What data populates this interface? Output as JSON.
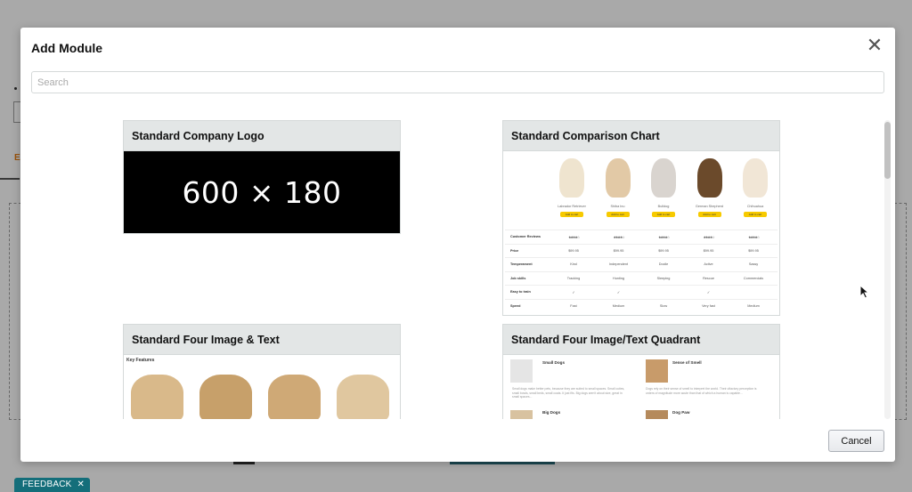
{
  "modal": {
    "title": "Add Module",
    "close_symbol": "✕",
    "search_placeholder": "Search",
    "cancel_label": "Cancel"
  },
  "background": {
    "orange_text": "E",
    "feedback_label": "FEEDBACK",
    "feedback_close": "✕"
  },
  "modules": {
    "company_logo": {
      "title": "Standard Company Logo",
      "preview_text": "600 × 180"
    },
    "comparison_chart": {
      "title": "Standard Comparison Chart",
      "dogs": [
        {
          "name": "Labrador Retriever",
          "button": "Add to cart",
          "color": "#efe4cf"
        },
        {
          "name": "Shiba Inu",
          "button": "Add to cart",
          "color": "#e2c9a6"
        },
        {
          "name": "Bulldog",
          "button": "Add to cart",
          "color": "#d9d4cf"
        },
        {
          "name": "German Shepherd",
          "button": "Add to cart",
          "color": "#6b4a2b"
        },
        {
          "name": "Chihuahua",
          "button": "Add to cart",
          "color": "#f1e6d6"
        }
      ],
      "rows": [
        {
          "label": "Customer Reviews",
          "cells": [
            "★★★★☆",
            "★★★★☆",
            "★★★★☆",
            "★★★★☆",
            "★★★★☆"
          ]
        },
        {
          "label": "Price",
          "cells": [
            "$99.95",
            "$99.95",
            "$99.95",
            "$99.95",
            "$99.95"
          ]
        },
        {
          "label": "Temperament",
          "cells": [
            "Kind",
            "Independent",
            "Docile",
            "Active",
            "Sassy"
          ]
        },
        {
          "label": "Job skills",
          "cells": [
            "Tracking",
            "Hunting",
            "Sleeping",
            "Rescue",
            "Commercials"
          ]
        },
        {
          "label": "Easy to train",
          "cells": [
            "✓",
            "✓",
            "",
            "✓",
            ""
          ]
        },
        {
          "label": "Speed",
          "cells": [
            "Fast",
            "Medium",
            "Slow",
            "Very fast",
            "Medium"
          ]
        }
      ]
    },
    "four_image_text": {
      "title": "Standard Four Image & Text",
      "section_label": "Key Features",
      "images": [
        "#d9b98a",
        "#c7a06a",
        "#cfa976",
        "#e0c79f"
      ]
    },
    "four_image_quadrant": {
      "title": "Standard Four Image/Text Quadrant",
      "items": [
        {
          "title": "Small Dogs",
          "text": "Small dogs make better pets, because they are suited to small spaces. Small cuties, small bowls, small beds, small coats. It just fits. Big dogs aren't about size, great in small spaces...",
          "thumb": "#e5e5e5"
        },
        {
          "title": "Sense of Smell",
          "text": "Dogs rely on their sense of smell to interpret the world. Their olfactory perception is orders of magnitude more acute than that of which a human is capable...",
          "thumb": "#c89b6a"
        },
        {
          "title": "Big Dogs",
          "text": "",
          "thumb": "#d8c2a0"
        },
        {
          "title": "Dog Paw",
          "text": "",
          "thumb": "#b58a5c"
        }
      ]
    }
  }
}
